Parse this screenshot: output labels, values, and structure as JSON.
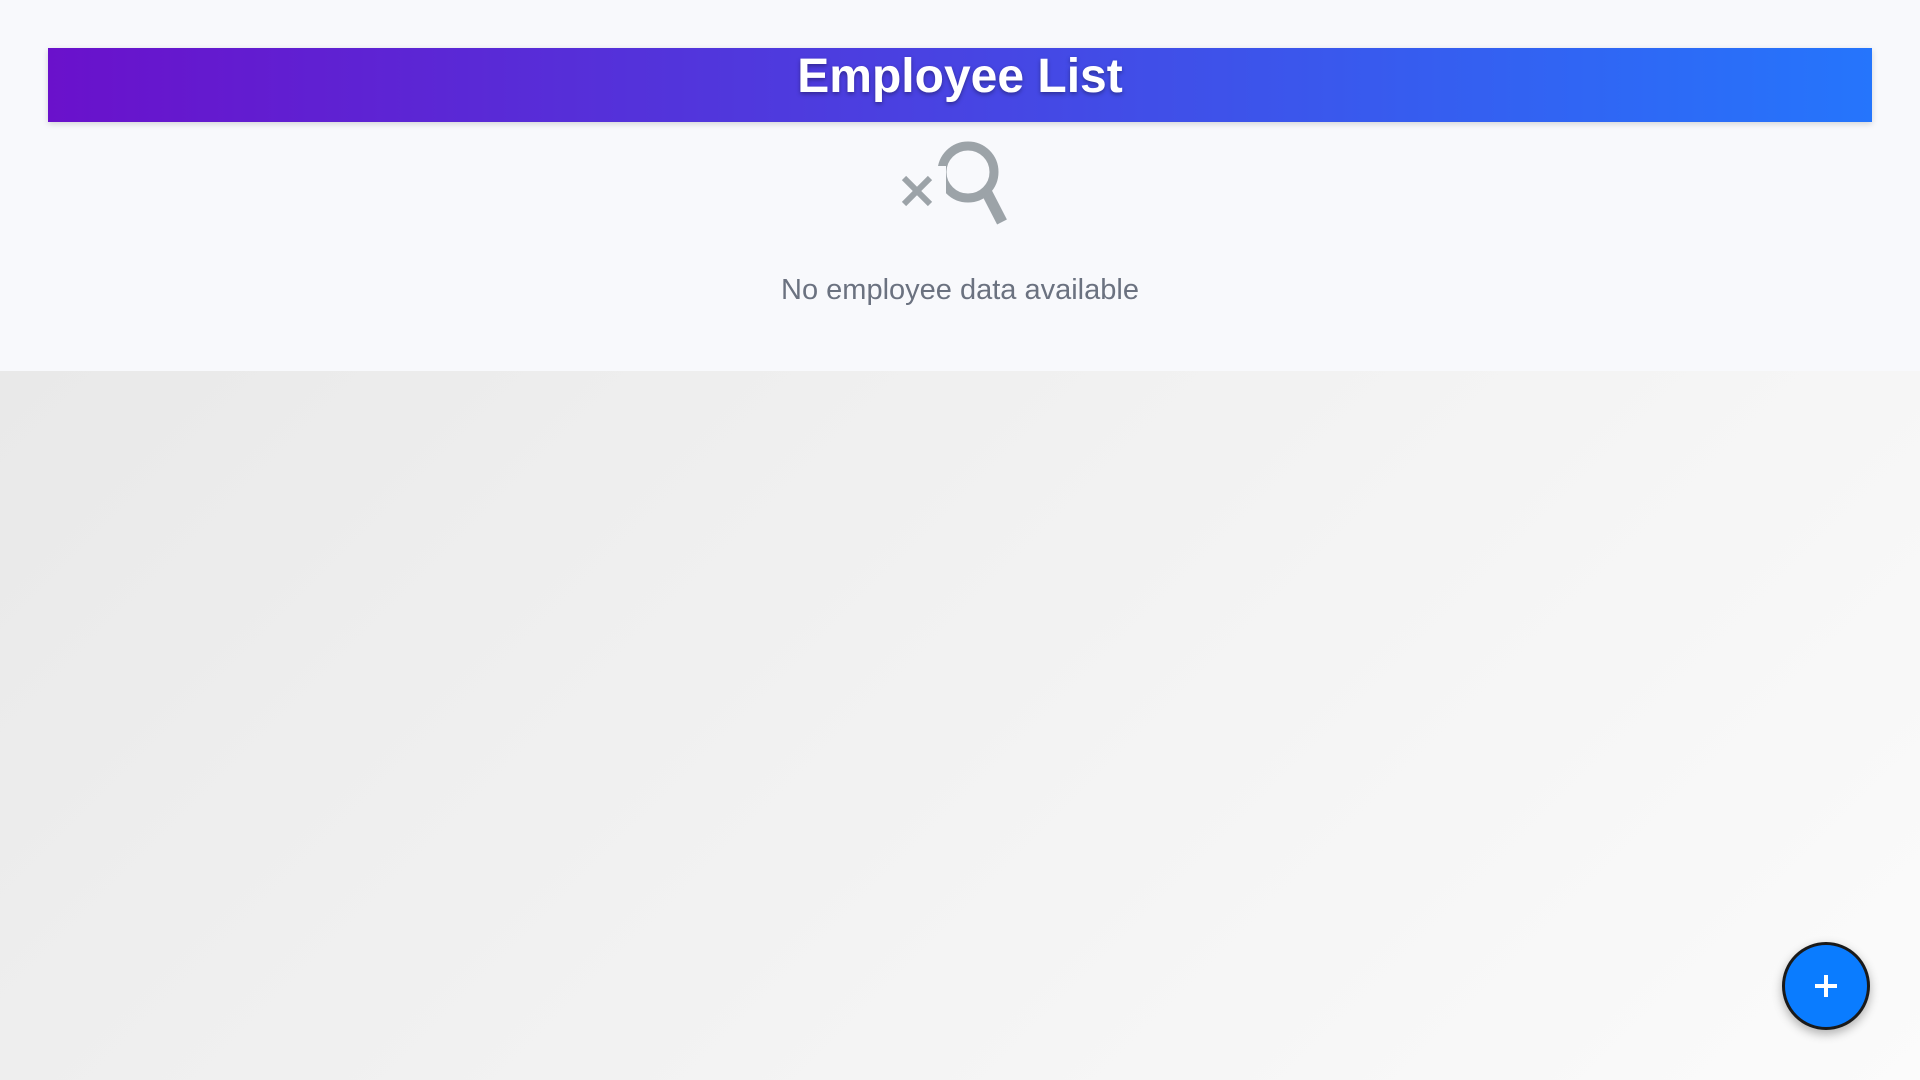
{
  "header": {
    "title": "Employee List",
    "gradient_start": "#6a11cb",
    "gradient_end": "#2575fc"
  },
  "empty_state": {
    "icon": "search-off-icon",
    "message": "No employee data available"
  },
  "fab": {
    "icon": "plus-icon",
    "color": "#0a7cff"
  }
}
